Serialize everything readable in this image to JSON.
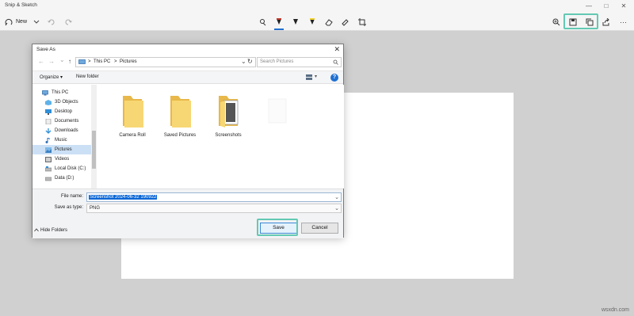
{
  "app": {
    "title": "Snip & Sketch",
    "new_label": "New",
    "window_controls": {
      "minimize": "—",
      "maximize": "□",
      "close": "✕"
    },
    "more_label": "···"
  },
  "dialog": {
    "title": "Save As",
    "close": "✕",
    "nav": {
      "back": "←",
      "forward": "→",
      "dropdown": "⌄",
      "up": "↑"
    },
    "address": {
      "sep1": ">",
      "pc": "This PC",
      "sep2": ">",
      "folder": "Pictures",
      "chevron": "⌄",
      "refresh": "↻"
    },
    "search_placeholder": "Search Pictures",
    "organize_label": "Organize ▾",
    "new_folder_label": "New folder",
    "view_arrow": "▾",
    "help": "?",
    "nav_items": [
      {
        "label": "This PC",
        "icon": "computer-icon"
      },
      {
        "label": "3D Objects",
        "icon": "cube-icon"
      },
      {
        "label": "Desktop",
        "icon": "desktop-icon"
      },
      {
        "label": "Documents",
        "icon": "document-icon"
      },
      {
        "label": "Downloads",
        "icon": "download-icon"
      },
      {
        "label": "Music",
        "icon": "music-icon"
      },
      {
        "label": "Pictures",
        "icon": "pictures-icon",
        "selected": true
      },
      {
        "label": "Videos",
        "icon": "video-icon"
      },
      {
        "label": "Local Disk (C:)",
        "icon": "drive-icon"
      },
      {
        "label": "Data (D:)",
        "icon": "drive-icon"
      }
    ],
    "folders": [
      {
        "label": "Camera Roll"
      },
      {
        "label": "Saved Pictures"
      },
      {
        "label": "Screenshots"
      }
    ],
    "file_name_label": "File name:",
    "file_name_value": "Screenshot 2024-06-32 190922",
    "save_type_label": "Save as type:",
    "save_type_value": "PNG",
    "hide_folders_label": "Hide Folders",
    "save_button": "Save",
    "cancel_button": "Cancel"
  },
  "colors": {
    "accent": "#1f6fd1",
    "highlight": "#63c9b3"
  },
  "watermark": "wsxdn.com"
}
